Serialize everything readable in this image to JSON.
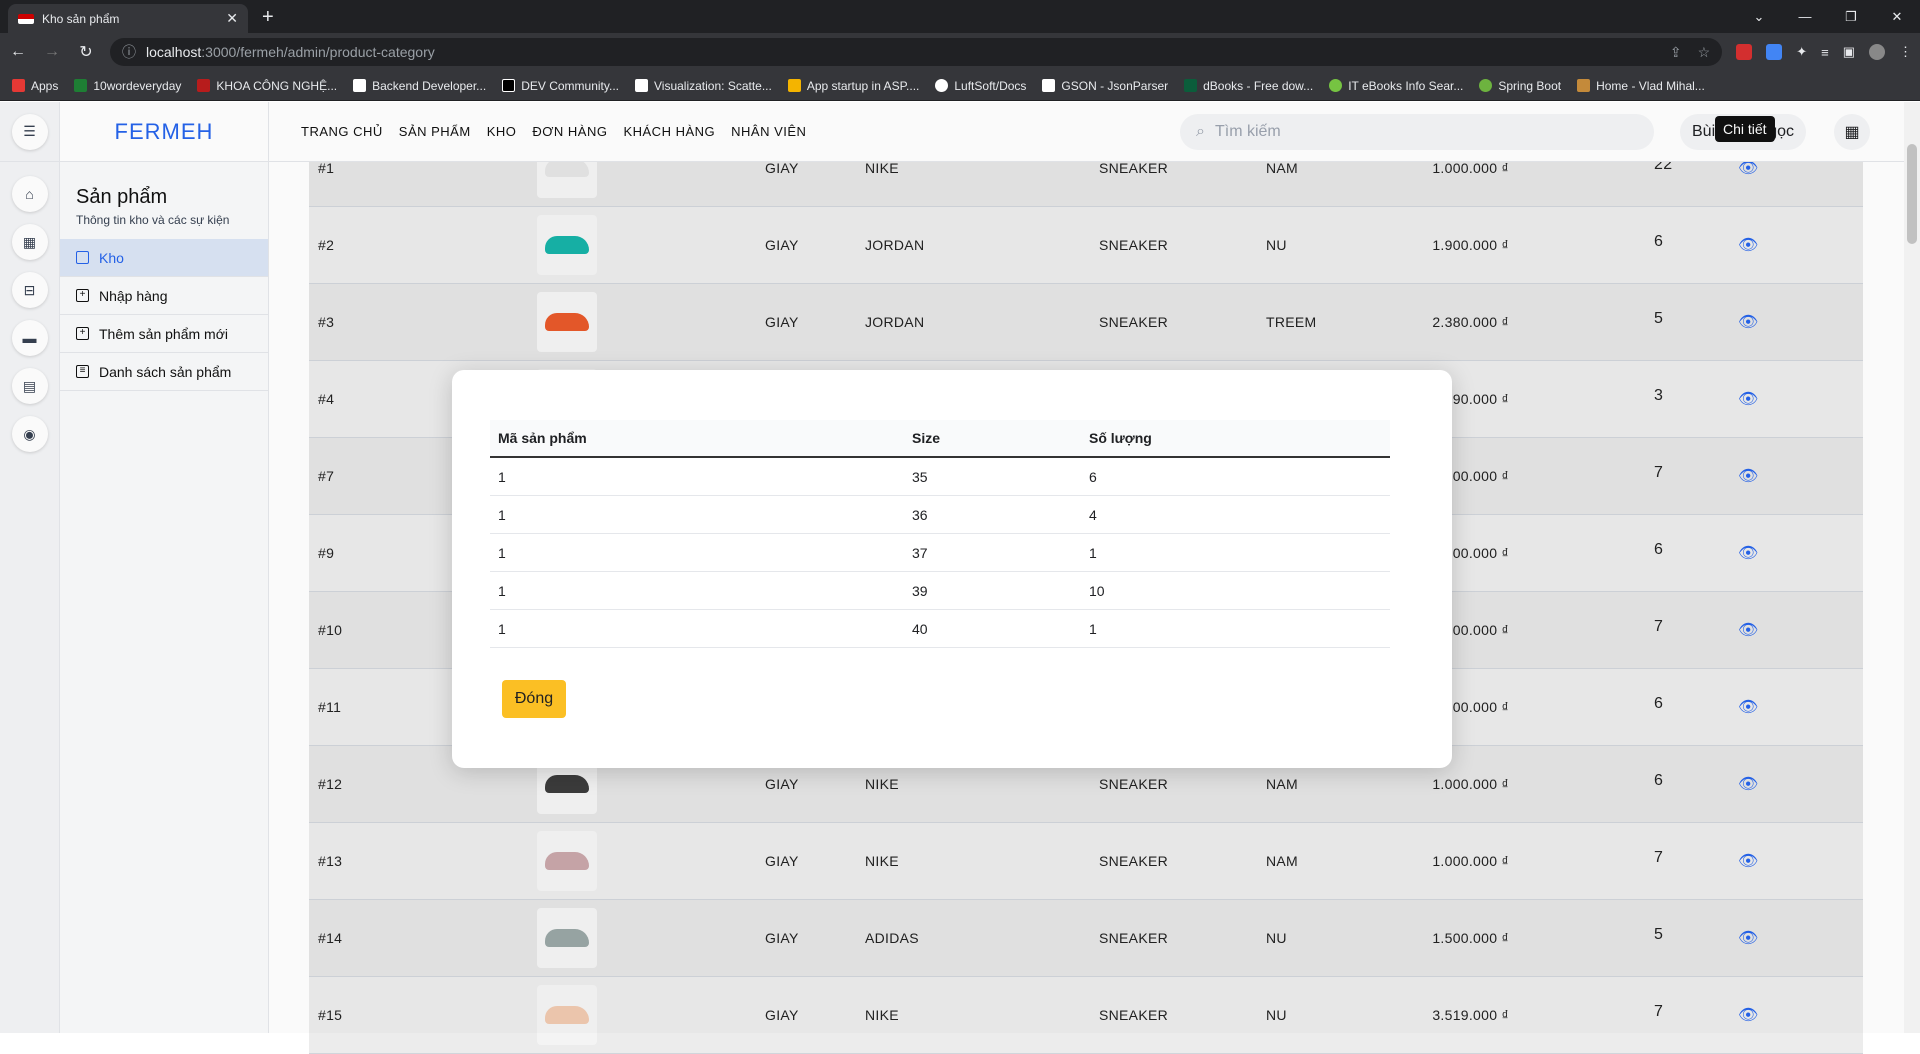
{
  "browser": {
    "tab_title": "Kho sản phẩm",
    "url_host": "localhost",
    "url_path": ":3000/fermeh/admin/product-category",
    "bookmarks": [
      "Apps",
      "10wordeveryday",
      "KHOA CÔNG NGHỆ...",
      "Backend Developer...",
      "DEV Community...",
      "Visualization: Scatte...",
      "App startup in ASP....",
      "LuftSoft/Docs",
      "GSON - JsonParser",
      "dBooks - Free dow...",
      "IT eBooks Info Sear...",
      "Spring Boot",
      "Home - Vlad Mihal..."
    ]
  },
  "header": {
    "logo": "FERMEH",
    "menu": [
      "TRANG CHỦ",
      "SẢN PHẨM",
      "KHO",
      "ĐƠN HÀNG",
      "KHÁCH HÀNG",
      "NHÂN VIÊN"
    ],
    "search_placeholder": "Tìm kiếm",
    "user_left": "Bùi",
    "user_right": "gọc",
    "tooltip": "Chi tiết"
  },
  "sidebar": {
    "title": "Sản phẩm",
    "subtitle": "Thông tin kho và các sự kiện",
    "items": [
      "Kho",
      "Nhập hàng",
      "Thêm sản phẩm mới",
      "Danh sách sản phẩm"
    ]
  },
  "rows": [
    {
      "id": "#1",
      "type": "GIAY",
      "brand": "NIKE",
      "cat": "SNEAKER",
      "gender": "NAM",
      "price": "1.000.000 ₫",
      "qty": "22",
      "color": "#e5e5e5"
    },
    {
      "id": "#2",
      "type": "GIAY",
      "brand": "JORDAN",
      "cat": "SNEAKER",
      "gender": "NU",
      "price": "1.900.000 ₫",
      "qty": "6",
      "color": "#17b3a8"
    },
    {
      "id": "#3",
      "type": "GIAY",
      "brand": "JORDAN",
      "cat": "SNEAKER",
      "gender": "TREEM",
      "price": "2.380.000 ₫",
      "qty": "5",
      "color": "#e8592a"
    },
    {
      "id": "#4",
      "type": "",
      "brand": "",
      "cat": "",
      "gender": "",
      "price": ".090.000 ₫",
      "qty": "3",
      "color": "#ddd"
    },
    {
      "id": "#7",
      "type": "",
      "brand": "",
      "cat": "",
      "gender": "",
      "price": ".000.000 ₫",
      "qty": "7",
      "color": "#ddd"
    },
    {
      "id": "#9",
      "type": "",
      "brand": "",
      "cat": "",
      "gender": "",
      "price": ".100.000 ₫",
      "qty": "6",
      "color": "#ddd"
    },
    {
      "id": "#10",
      "type": "",
      "brand": "",
      "cat": "",
      "gender": "",
      "price": ".000.000 ₫",
      "qty": "7",
      "color": "#ddd"
    },
    {
      "id": "#11",
      "type": "",
      "brand": "",
      "cat": "",
      "gender": "",
      "price": ".000.000 ₫",
      "qty": "6",
      "color": "#ddd"
    },
    {
      "id": "#12",
      "type": "GIAY",
      "brand": "NIKE",
      "cat": "SNEAKER",
      "gender": "NAM",
      "price": "1.000.000 ₫",
      "qty": "6",
      "color": "#3d3d3d"
    },
    {
      "id": "#13",
      "type": "GIAY",
      "brand": "NIKE",
      "cat": "SNEAKER",
      "gender": "NAM",
      "price": "1.000.000 ₫",
      "qty": "7",
      "color": "#c9a7aa"
    },
    {
      "id": "#14",
      "type": "GIAY",
      "brand": "ADIDAS",
      "cat": "SNEAKER",
      "gender": "NU",
      "price": "1.500.000 ₫",
      "qty": "5",
      "color": "#9aa7a6"
    },
    {
      "id": "#15",
      "type": "GIAY",
      "brand": "NIKE",
      "cat": "SNEAKER",
      "gender": "NU",
      "price": "3.519.000 ₫",
      "qty": "7",
      "color": "#f0c9b0"
    }
  ],
  "modal": {
    "headers": [
      "Mã sản phẩm",
      "Size",
      "Số lượng"
    ],
    "rows": [
      [
        "1",
        "35",
        "6"
      ],
      [
        "1",
        "36",
        "4"
      ],
      [
        "1",
        "37",
        "1"
      ],
      [
        "1",
        "39",
        "10"
      ],
      [
        "1",
        "40",
        "1"
      ]
    ],
    "close_label": "Đóng"
  }
}
